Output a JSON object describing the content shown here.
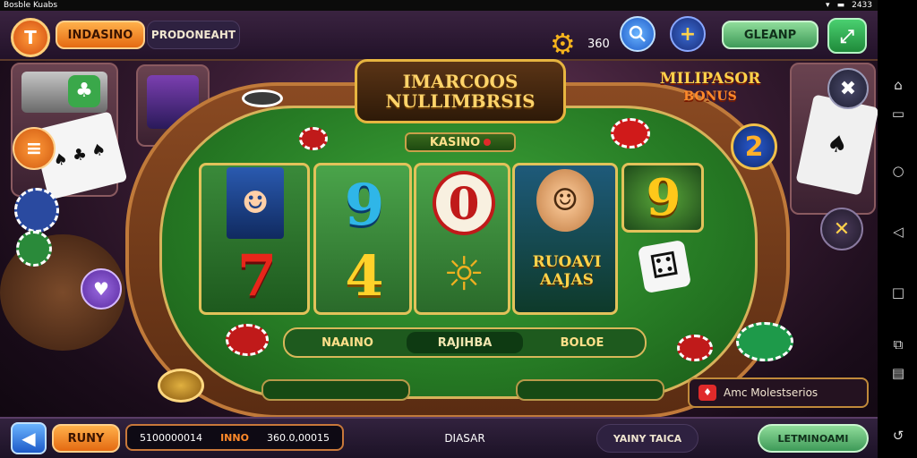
{
  "status_bar": {
    "left": "Bosble Kuabs",
    "right_time": "2433"
  },
  "top_bar": {
    "logo_glyph": "T",
    "mode_label": "INDASINO",
    "promo_label": "PRODONEAHT",
    "coin_balance": "360",
    "search_icon": "search-icon",
    "plus_icon": "plus-icon",
    "cta_label": "GLEANP",
    "expand_icon": "expand-icon"
  },
  "game": {
    "title_line1": "IMARCOOS",
    "title_line2": "NULLIMBRSIS",
    "side_banner": "MILIPASOR",
    "side_banner_sub": "BONUS",
    "center_label": "KASINO",
    "reels": {
      "r1_bottom": "7",
      "r2_top": "9",
      "r2_bottom": "4",
      "r3_top": "0",
      "r4_text": "RUOAVI AAJAS",
      "r5_top": "9"
    },
    "multiplier": "2",
    "table_options": [
      "NAAINO",
      "RAJIHBA",
      "BOLOE"
    ],
    "info_text": "Amc Molestserios"
  },
  "bottom_bar": {
    "back_icon": "arrow-left-icon",
    "bet_label": "RUNY",
    "balance_value": "5100000014",
    "win_label": "INNO",
    "win_value": "360.0,00015",
    "center_text": "DIASAR",
    "secondary_button": "YAINY TAICA",
    "primary_button": "LETMINOAMI"
  },
  "colors": {
    "accent": "#f0862a",
    "felt": "#2e8a2a",
    "gold": "#e2c25a",
    "cta_green": "#5bbf6e"
  }
}
